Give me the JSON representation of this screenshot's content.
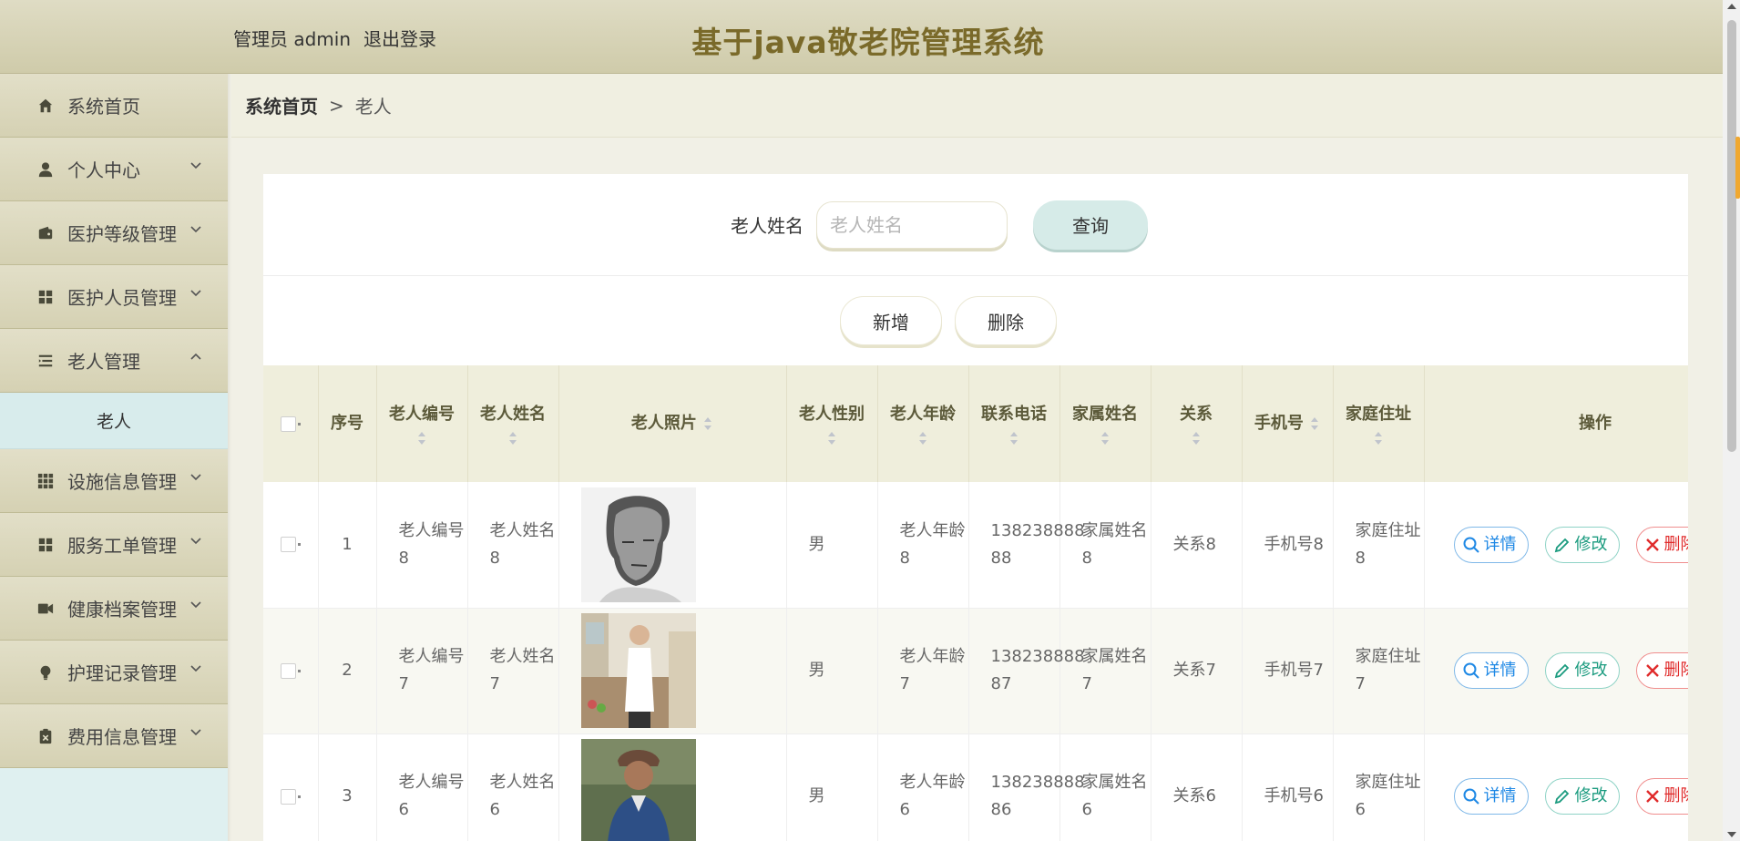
{
  "header": {
    "admin_text": "管理员 admin",
    "logout": "退出登录",
    "title": "基于java敬老院管理系统"
  },
  "sidebar": {
    "items": [
      {
        "label": "系统首页",
        "icon": "home-icon"
      },
      {
        "label": "个人中心",
        "icon": "user-icon"
      },
      {
        "label": "医护等级管理",
        "icon": "wallet-icon"
      },
      {
        "label": "医护人员管理",
        "icon": "grid-icon"
      },
      {
        "label": "老人管理",
        "icon": "list-icon"
      },
      {
        "label": "设施信息管理",
        "icon": "apps-icon"
      },
      {
        "label": "服务工单管理",
        "icon": "grid-icon"
      },
      {
        "label": "健康档案管理",
        "icon": "video-icon"
      },
      {
        "label": "护理记录管理",
        "icon": "bulb-icon"
      },
      {
        "label": "费用信息管理",
        "icon": "clipboard-icon"
      }
    ],
    "submenu": "老人"
  },
  "breadcrumb": {
    "home": "系统首页",
    "sep": ">",
    "current": "老人"
  },
  "search": {
    "label": "老人姓名",
    "placeholder": "老人姓名",
    "value": "",
    "button": "查询"
  },
  "actions": {
    "add": "新增",
    "delete": "删除"
  },
  "table": {
    "headers": {
      "index": "序号",
      "code": "老人编号",
      "name": "老人姓名",
      "photo": "老人照片",
      "gender": "老人性别",
      "age": "老人年龄",
      "phone": "联系电话",
      "family_name": "家属姓名",
      "relation": "关系",
      "mobile": "手机号",
      "address": "家庭住址",
      "ops": "操作"
    },
    "rows": [
      {
        "index": "1",
        "code": "老人编号8",
        "name": "老人姓名8",
        "gender": "男",
        "age": "老人年龄8",
        "phone": "138238888 88",
        "family_name": "家属姓名8",
        "relation": "关系8",
        "mobile": "手机号8",
        "address": "家庭住址8"
      },
      {
        "index": "2",
        "code": "老人编号7",
        "name": "老人姓名7",
        "gender": "男",
        "age": "老人年龄7",
        "phone": "138238888 87",
        "family_name": "家属姓名7",
        "relation": "关系7",
        "mobile": "手机号7",
        "address": "家庭住址7"
      },
      {
        "index": "3",
        "code": "老人编号6",
        "name": "老人姓名6",
        "gender": "男",
        "age": "老人年龄6",
        "phone": "138238888 86",
        "family_name": "家属姓名6",
        "relation": "关系6",
        "mobile": "手机号6",
        "address": "家庭住址6"
      }
    ],
    "op_labels": {
      "detail": "详情",
      "edit": "修改",
      "del": "删除"
    }
  }
}
